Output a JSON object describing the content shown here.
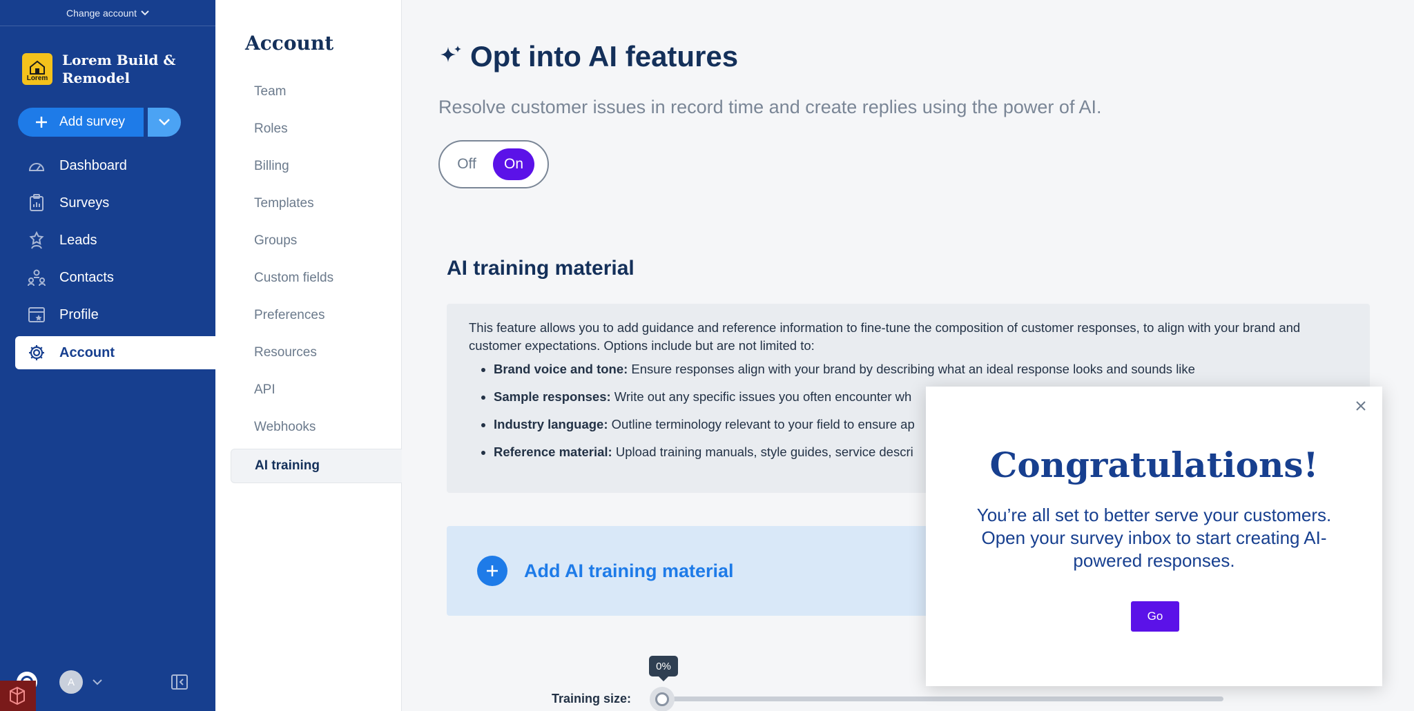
{
  "left_nav": {
    "change_account": "Change account",
    "brand_name": "Lorem Build & Remodel",
    "brand_logo_text": "Lorem",
    "add_survey": "Add survey",
    "items": [
      {
        "label": "Dashboard",
        "icon": "dashboard-gauge-icon"
      },
      {
        "label": "Surveys",
        "icon": "clipboard-chart-icon"
      },
      {
        "label": "Leads",
        "icon": "star-person-icon"
      },
      {
        "label": "Contacts",
        "icon": "people-network-icon"
      },
      {
        "label": "Profile",
        "icon": "profile-calendar-star-icon"
      },
      {
        "label": "Account",
        "icon": "gear-icon",
        "active": true
      }
    ],
    "avatar_initial": "A"
  },
  "sub_nav": {
    "title": "Account",
    "items": [
      "Team",
      "Roles",
      "Billing",
      "Templates",
      "Groups",
      "Custom fields",
      "Preferences",
      "Resources",
      "API",
      "Webhooks",
      "AI training"
    ],
    "active": "AI training"
  },
  "main": {
    "title": "Opt into AI features",
    "subtitle": "Resolve customer issues in record time and create replies using the power of AI.",
    "toggle": {
      "off": "Off",
      "on": "On",
      "value": "On"
    },
    "section_title": "AI training material",
    "info_intro": "This feature allows you to add guidance and reference information to fine-tune the composition of customer responses, to align with your brand and customer expectations. Options include but are not limited to:",
    "bullets": [
      {
        "term": "Brand voice and tone:",
        "text": " Ensure responses align with your brand by describing what an ideal response looks and sounds like"
      },
      {
        "term": "Sample responses:",
        "text": " Write out any specific issues you often encounter wh"
      },
      {
        "term": "Industry language:",
        "text": " Outline terminology relevant to your field to ensure ap"
      },
      {
        "term": "Reference material:",
        "text": " Upload training manuals, style guides, service descri"
      }
    ],
    "add_material": "Add AI training material",
    "training_size_label": "Training size:",
    "training_size_value": "0%"
  },
  "modal": {
    "title": "Congratulations!",
    "message": "You’re all set to better serve your customers. Open your survey inbox to start creating AI-powered responses.",
    "go_button": "Go"
  },
  "colors": {
    "nav_bg": "#173f8f",
    "primary_blue": "#1e7be8",
    "purple": "#5b12e8",
    "heading": "#14305a"
  }
}
